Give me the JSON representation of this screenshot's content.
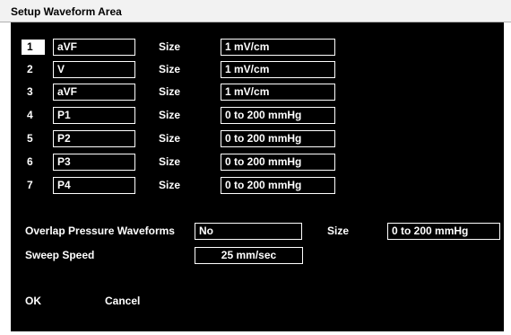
{
  "window": {
    "title": "Setup Waveform Area"
  },
  "rows": [
    {
      "number": "1",
      "lead": "aVF",
      "size_label": "Size",
      "size": "1 mV/cm"
    },
    {
      "number": "2",
      "lead": "V",
      "size_label": "Size",
      "size": "1 mV/cm"
    },
    {
      "number": "3",
      "lead": "aVF",
      "size_label": "Size",
      "size": "1 mV/cm"
    },
    {
      "number": "4",
      "lead": "P1",
      "size_label": "Size",
      "size": "0 to 200 mmHg"
    },
    {
      "number": "5",
      "lead": "P2",
      "size_label": "Size",
      "size": "0 to 200 mmHg"
    },
    {
      "number": "6",
      "lead": "P3",
      "size_label": "Size",
      "size": "0 to 200 mmHg"
    },
    {
      "number": "7",
      "lead": "P4",
      "size_label": "Size",
      "size": "0 to 200 mmHg"
    }
  ],
  "overlap": {
    "label": "Overlap Pressure Waveforms",
    "value": "No",
    "size_label": "Size",
    "size": "0 to 200 mmHg"
  },
  "sweep": {
    "label": "Sweep Speed",
    "value": "25 mm/sec"
  },
  "buttons": {
    "ok": "OK",
    "cancel": "Cancel"
  },
  "colors": {
    "background": "#000000",
    "text": "#ffffff",
    "selected_number_bg": "#ffffff"
  }
}
